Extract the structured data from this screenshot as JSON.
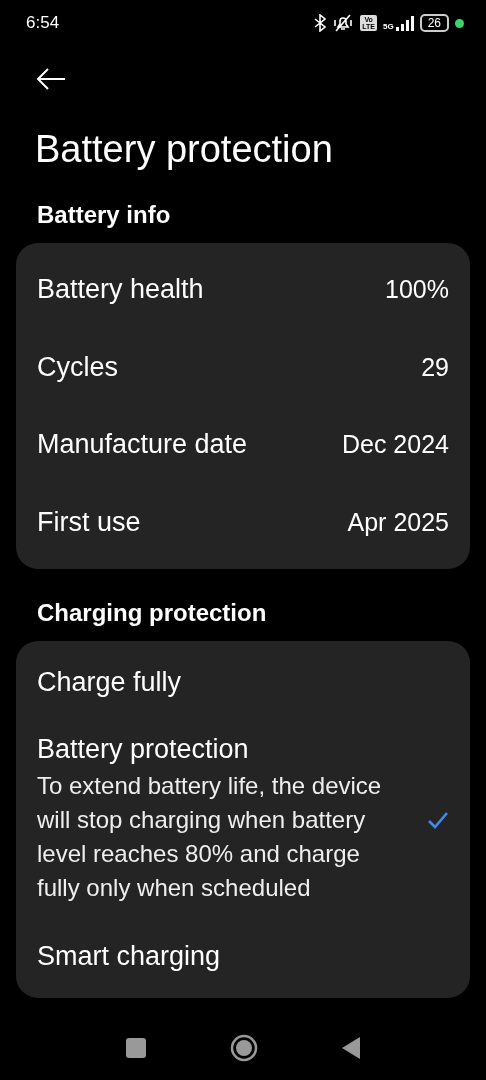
{
  "status_bar": {
    "time": "6:54",
    "volte": [
      "Vo",
      "LTE"
    ],
    "network": "5G",
    "battery": "26"
  },
  "title": "Battery protection",
  "sections": [
    {
      "heading": "Battery info",
      "rows": [
        {
          "label": "Battery health",
          "value": "100%"
        },
        {
          "label": "Cycles",
          "value": "29"
        },
        {
          "label": "Manufacture date",
          "value": "Dec 2024"
        },
        {
          "label": "First use",
          "value": "Apr 2025"
        }
      ]
    },
    {
      "heading": "Charging protection",
      "options": [
        {
          "label": "Charge fully",
          "selected": false
        },
        {
          "label": "Battery protection",
          "description": "To extend battery life, the device will stop charging when battery level reaches 80% and charge fully only when scheduled",
          "selected": true
        },
        {
          "label": "Smart charging",
          "selected": false
        }
      ]
    }
  ]
}
